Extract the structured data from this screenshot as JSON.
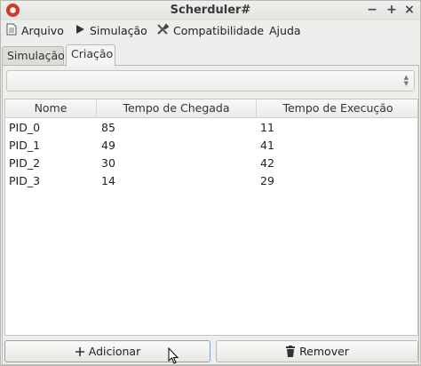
{
  "window": {
    "title": "Scherduler#"
  },
  "window_controls": {
    "minimize": "−",
    "maximize": "+",
    "close": "×"
  },
  "menu": [
    {
      "label": "Arquivo",
      "icon": "document-icon"
    },
    {
      "label": "Simulação",
      "icon": "play-icon"
    },
    {
      "label": "Compatibilidade",
      "icon": "tools-icon"
    },
    {
      "label": "Ajuda",
      "icon": ""
    }
  ],
  "tabs": [
    {
      "label": "Simulação",
      "active": false
    },
    {
      "label": "Criação",
      "active": true
    }
  ],
  "combo": {
    "value": ""
  },
  "table": {
    "columns": [
      "Nome",
      "Tempo de Chegada",
      "Tempo de Execução"
    ],
    "rows": [
      [
        "PID_0",
        "85",
        "11"
      ],
      [
        "PID_1",
        "49",
        "41"
      ],
      [
        "PID_2",
        "30",
        "42"
      ],
      [
        "PID_3",
        "14",
        "29"
      ]
    ]
  },
  "buttons": {
    "add": "Adicionar",
    "remove": "Remover"
  },
  "colors": {
    "accent_focus": "#7fa3cf",
    "icon_red": "#d23a2a"
  }
}
